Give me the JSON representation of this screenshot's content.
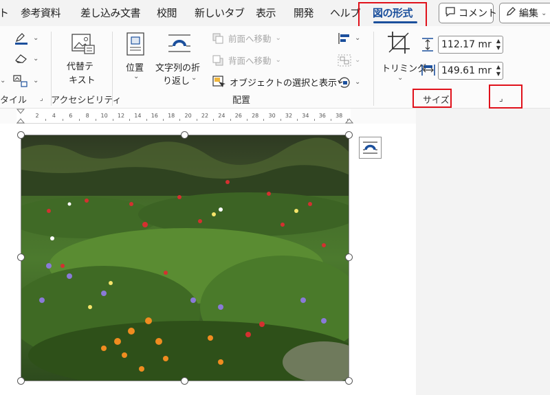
{
  "tabs": {
    "partial_left": "ト",
    "references": "参考資料",
    "mailings": "差し込み文書",
    "review": "校閲",
    "new_tab": "新しいタブ",
    "view": "表示",
    "developer": "開発",
    "help": "ヘルプ",
    "picture_format": "図の形式"
  },
  "header": {
    "comment_label": "コメント",
    "edit_label": "編集"
  },
  "ribbon": {
    "style_group_label": "タイル",
    "alt_text_label_line1": "代替テ",
    "alt_text_label_line2": "キスト",
    "accessibility_group_label": "アクセシビリティ",
    "position_label": "位置",
    "wrap_text_line1": "文字列の折",
    "wrap_text_line2": "り返し",
    "bring_forward_label": "前面へ移動",
    "send_backward_label": "背面へ移動",
    "selection_pane_label": "オブジェクトの選択と表示",
    "arrange_group_label": "配置",
    "crop_label": "トリミング",
    "height_value": "112.17 mr",
    "width_value": "149.61 mr",
    "size_group_label": "サイズ",
    "size_launcher_glyph": "⌟"
  },
  "ruler": {
    "labels": [
      "2",
      "4",
      "6",
      "8",
      "10",
      "12",
      "14",
      "16",
      "18",
      "20",
      "22",
      "24",
      "26",
      "28",
      "30",
      "32",
      "34",
      "36",
      "38"
    ]
  },
  "colors": {
    "accent": "#1b4f9c",
    "highlight_box": "#e0101a"
  },
  "icons": {
    "comment": "speech-bubble-icon",
    "edit": "pencil-icon",
    "alt_text": "alt-text-icon",
    "position": "position-icon",
    "wrap_text": "wrap-text-icon",
    "crop": "crop-icon",
    "layout_options": "layout-options-icon"
  }
}
